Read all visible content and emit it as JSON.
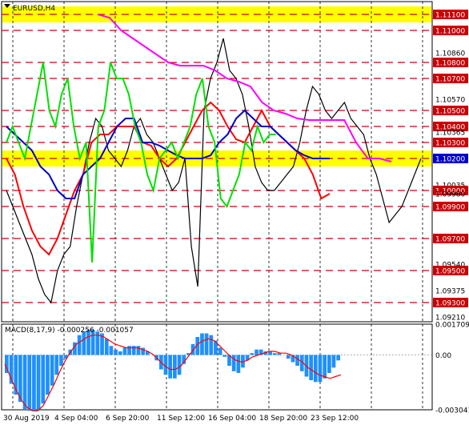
{
  "chart_data": [
    {
      "type": "line",
      "title": "EURUSD,H4",
      "ylim": [
        1.0918,
        1.1118
      ],
      "grid": true,
      "y_ticks": [
        "1.11100",
        "1.11000",
        "1.10860",
        "1.10800",
        "1.10700",
        "1.10570",
        "1.10500",
        "1.10400",
        "1.10365",
        "1.10300",
        "1.10200",
        "1.10035",
        "1.10000",
        "1.09980",
        "1.09900",
        "1.09700",
        "1.09540",
        "1.09500",
        "1.09375",
        "1.09300",
        "1.09210"
      ],
      "levels": [
        1.111,
        1.11,
        1.108,
        1.107,
        1.105,
        1.104,
        1.103,
        1.102,
        1.1,
        1.099,
        1.097,
        1.095,
        1.093
      ],
      "highlighted_levels": [
        1.111,
        1.102
      ],
      "current_price": 1.102,
      "x_ticks": [
        "30 Aug 2019",
        "4 Sep 04:00",
        "6 Sep 20:00",
        "11 Sep 12:00",
        "16 Sep 04:00",
        "18 Sep 20:00",
        "23 Sep 12:00"
      ],
      "series": [
        {
          "key": "price",
          "color": "#000000",
          "values": [
            1.1,
            1.099,
            1.098,
            1.097,
            1.096,
            1.0945,
            1.0935,
            1.093,
            1.095,
            1.096,
            1.0965,
            1.099,
            1.101,
            1.103,
            1.1045,
            1.104,
            1.1025,
            1.102,
            1.1015,
            1.1025,
            1.104,
            1.1045,
            1.1035,
            1.103,
            1.102,
            1.101,
            1.1,
            1.1005,
            1.102,
            1.0965,
            1.094,
            1.105,
            1.107,
            1.108,
            1.1095,
            1.1075,
            1.107,
            1.106,
            1.104,
            1.1015,
            1.1005,
            1.1,
            1.1,
            1.1005,
            1.101,
            1.1015,
            1.103,
            1.105,
            1.1065,
            1.106,
            1.105,
            1.1045,
            1.105,
            1.1055,
            1.1045,
            1.104,
            1.1035,
            1.102,
            1.101,
            1.0995,
            1.098,
            1.0985,
            1.099,
            1.1,
            1.101,
            1.102
          ]
        },
        {
          "key": "tenkan",
          "color": "#ff0000",
          "values": [
            1.102,
            1.101,
            1.099,
            1.0975,
            1.0965,
            1.096,
            1.097,
            1.0985,
            1.1,
            1.101,
            1.103,
            1.1035,
            1.1035,
            1.104,
            1.104,
            1.104,
            1.103,
            1.1028,
            1.102,
            1.1015,
            1.102,
            1.103,
            1.104,
            1.105,
            1.1055,
            1.105,
            1.104,
            1.1032,
            1.103,
            1.104,
            1.105,
            1.104,
            1.1035,
            1.103,
            1.1025,
            1.102,
            1.101,
            1.0995,
            1.0998
          ]
        },
        {
          "key": "kijun",
          "color": "#0000cd",
          "values": [
            1.104,
            1.1035,
            1.103,
            1.1025,
            1.1015,
            1.101,
            1.1,
            1.0995,
            1.0995,
            1.101,
            1.1015,
            1.102,
            1.103,
            1.104,
            1.1045,
            1.1045,
            1.103,
            1.103,
            1.1028,
            1.1025,
            1.1022,
            1.102,
            1.102,
            1.102,
            1.1022,
            1.103,
            1.1035,
            1.1045,
            1.105,
            1.1045,
            1.104,
            1.104,
            1.1035,
            1.103,
            1.1025,
            1.1022,
            1.102,
            1.102,
            1.102
          ]
        },
        {
          "key": "chikou",
          "color": "#00e000",
          "values": [
            1.103,
            1.104,
            1.103,
            1.102,
            1.104,
            1.106,
            1.108,
            1.105,
            1.104,
            1.106,
            1.107,
            1.104,
            1.102,
            1.103,
            1.0955,
            1.104,
            1.105,
            1.108,
            1.107,
            1.107,
            1.106,
            1.104,
            1.103,
            1.101,
            1.1,
            1.102,
            1.1025,
            1.103,
            1.102,
            1.103,
            1.104,
            1.106,
            1.107,
            1.104,
            1.103,
            1.0995,
            1.099,
            1.1,
            1.101,
            1.103,
            1.1025,
            1.104,
            1.103,
            1.1035,
            1.1035
          ]
        },
        {
          "key": "senkou_a",
          "color": "#ff00ff",
          "values": [
            1.111,
            1.1108,
            1.11,
            1.1095,
            1.109,
            1.1085,
            1.108,
            1.1078,
            1.1078,
            1.1078,
            1.1075,
            1.107,
            1.1068,
            1.1065,
            1.1055,
            1.105,
            1.1048,
            1.1045,
            1.1044,
            1.1044,
            1.1044,
            1.1044,
            1.103,
            1.102,
            1.102,
            1.1018
          ]
        }
      ]
    },
    {
      "type": "bar",
      "title": "MACD(8,17,9) -0.000256 -0.001057",
      "ylim": [
        -0.003041,
        0.001709
      ],
      "y_ticks": [
        "0.001709",
        "0.00",
        "-0.003041"
      ],
      "series": [
        {
          "key": "histogram",
          "color": "#1e90ff",
          "values": [
            -0.001,
            -0.0016,
            -0.0022,
            -0.0026,
            -0.003,
            -0.0031,
            -0.0031,
            -0.003,
            -0.0027,
            -0.0022,
            -0.0017,
            -0.0011,
            -0.0006,
            -0.0002,
            0.0003,
            0.0007,
            0.0011,
            0.0013,
            0.0014,
            0.0014,
            0.0013,
            0.0012,
            0.0009,
            0.0005,
            0.0003,
            0.0002,
            0.0004,
            0.0005,
            0.0005,
            0.0005,
            0.0004,
            0.0002,
            0.0,
            -0.0003,
            -0.0008,
            -0.0011,
            -0.0013,
            -0.0013,
            -0.0011,
            -0.0005,
            0.0001,
            0.0006,
            0.001,
            0.0012,
            0.0012,
            0.0011,
            0.0008,
            0.0004,
            -0.0001,
            -0.0006,
            -0.0009,
            -0.001,
            -0.0007,
            -0.0003,
            0.0001,
            0.0003,
            0.0003,
            0.0002,
            0.0002,
            0.0001,
            0.0001,
            0.0,
            -0.0002,
            -0.0004,
            -0.0006,
            -0.0009,
            -0.0012,
            -0.0014,
            -0.0015,
            -0.0015,
            -0.0013,
            -0.001,
            -0.0007,
            -0.0003
          ]
        },
        {
          "key": "signal",
          "color": "#ff0000",
          "values": [
            -0.0005,
            -0.0012,
            -0.0019,
            -0.0025,
            -0.0029,
            -0.0031,
            -0.0031,
            -0.0028,
            -0.0022,
            -0.0016,
            -0.0009,
            -0.0003,
            0.0002,
            0.0006,
            0.0008,
            0.001,
            0.0011,
            0.0011,
            0.001,
            0.0008,
            0.0006,
            0.0005,
            0.0004,
            0.0004,
            0.0004,
            0.0003,
            0.0002,
            0.0,
            -0.0003,
            -0.0006,
            -0.0008,
            -0.0008,
            -0.0006,
            -0.0002,
            0.0002,
            0.0006,
            0.0008,
            0.0009,
            0.0008,
            0.0005,
            0.0002,
            -0.0001,
            -0.0003,
            -0.0004,
            -0.0003,
            -0.0001,
            0.0,
            0.0001,
            0.0002,
            0.0002,
            0.0001,
            0.0001,
            0.0,
            -0.0002,
            -0.0004,
            -0.0007,
            -0.0009,
            -0.0011,
            -0.0012,
            -0.0013,
            -0.0012,
            -0.0011
          ]
        }
      ]
    }
  ]
}
